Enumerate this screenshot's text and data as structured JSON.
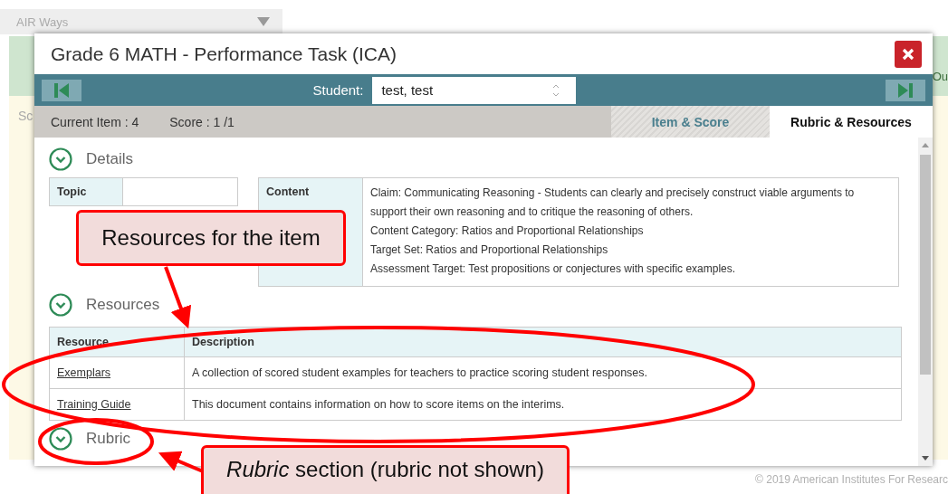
{
  "background": {
    "app_menu": "AIR Ways",
    "side_label": "Sc",
    "side_text": "Ou",
    "footer": "© 2019 American Institutes For Researc"
  },
  "dialog": {
    "title": "Grade 6 MATH - Performance Task (ICA)",
    "student_label": "Student:",
    "student_value": "test, test",
    "current_item": "Current Item : 4",
    "score": "Score : 1 /1",
    "tabs": [
      {
        "label": "Item & Score",
        "selected": false
      },
      {
        "label": "Rubric & Resources",
        "selected": true
      }
    ],
    "sections": [
      {
        "kind": "details",
        "title": "Details",
        "expanded": true,
        "topic_label": "Topic",
        "content_label": "Content",
        "content_lines": [
          "Claim: Communicating Reasoning - Students can clearly and precisely construct viable arguments to support their own reasoning and to critique the reasoning of others.",
          "Content Category: Ratios and Proportional Relationships",
          "Target Set: Ratios and Proportional Relationships",
          "Assessment Target: Test propositions or conjectures with specific examples."
        ]
      },
      {
        "kind": "resources",
        "title": "Resources",
        "expanded": true,
        "columns": [
          "Resource",
          "Description"
        ],
        "rows": [
          {
            "resource": "Exemplars",
            "description": "A collection of scored student examples for teachers to practice scoring student responses."
          },
          {
            "resource": "Training Guide",
            "description": "This document contains information on how to score items on the interims."
          }
        ]
      },
      {
        "kind": "rubric",
        "title": "Rubric",
        "expanded": true
      }
    ]
  },
  "annotations": [
    {
      "kind": "callout",
      "text": "Resources for the item"
    },
    {
      "kind": "callout",
      "text": "*Rubric* section (rubric not shown)"
    }
  ]
}
